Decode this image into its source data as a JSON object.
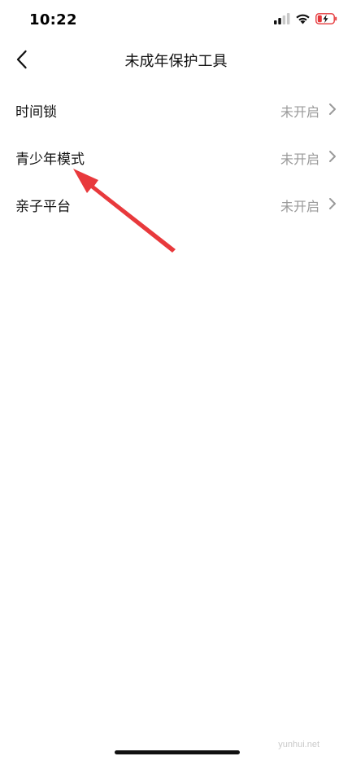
{
  "status_bar": {
    "time": "10:22",
    "icons": [
      "cellular-signal-icon",
      "wifi-icon",
      "battery-charging-icon"
    ],
    "battery_color": "#e5383b"
  },
  "nav": {
    "title": "未成年保护工具",
    "back_icon": "chevron-left-icon"
  },
  "items": [
    {
      "label": "时间锁",
      "status": "未开启"
    },
    {
      "label": "青少年模式",
      "status": "未开启"
    },
    {
      "label": "亲子平台",
      "status": "未开启"
    }
  ],
  "annotation": {
    "icon": "red-arrow-icon",
    "color": "#e8393c",
    "points_to": "青少年模式"
  },
  "watermark": "yunhui.net"
}
